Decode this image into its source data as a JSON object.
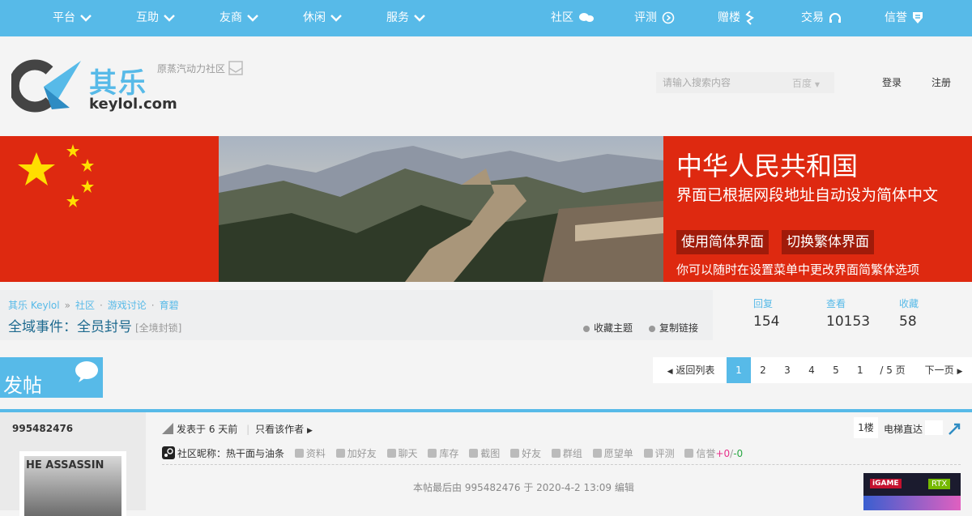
{
  "top_nav": {
    "left": [
      {
        "label": "平台"
      },
      {
        "label": "互助"
      },
      {
        "label": "友商"
      },
      {
        "label": "休闲"
      },
      {
        "label": "服务"
      }
    ],
    "right": [
      {
        "label": "社区"
      },
      {
        "label": "评测"
      },
      {
        "label": "赠楼"
      },
      {
        "label": "交易"
      },
      {
        "label": "信誉"
      }
    ]
  },
  "header": {
    "brand_cn": "其乐",
    "brand_en": "keylol.com",
    "subtitle": "原蒸汽动力社区",
    "search_placeholder": "请输入搜索内容",
    "search_engine": "百度",
    "login": "登录",
    "register": "注册"
  },
  "banner": {
    "country": "中华人民共和国",
    "notice": "界面已根据网段地址自动设为简体中文",
    "btn_simplified": "使用简体界面",
    "btn_traditional": "切换繁体界面",
    "hint": "你可以随时在设置菜单中更改界面简繁体选项",
    "colors": {
      "flag_red": "#de2910",
      "star_yellow": "#ffde00"
    }
  },
  "breadcrumb": [
    "其乐 Keylol",
    "社区",
    "游戏讨论",
    "育碧"
  ],
  "thread": {
    "title": "全域事件：全员封号",
    "tag": "[全境封锁]",
    "fav": "收藏主题",
    "copy": "复制链接"
  },
  "stats": [
    {
      "label": "回复",
      "value": "154"
    },
    {
      "label": "查看",
      "value": "10153"
    },
    {
      "label": "收藏",
      "value": "58"
    }
  ],
  "post_button": "发帖",
  "pagination": {
    "back": "返回列表",
    "pages": [
      "1",
      "2",
      "3",
      "4",
      "5"
    ],
    "current": "1",
    "input_value": "1",
    "total": "/ 5 页",
    "next": "下一页"
  },
  "post": {
    "author": "995482476",
    "avatar_text": "HE ASSASSIN",
    "posted": "发表于 6 天前",
    "only_author": "只看该作者",
    "floor": "1楼",
    "jump": "电梯直达",
    "nickname": "社区昵称：热干面与油条",
    "tools": [
      "资料",
      "加好友",
      "聊天",
      "库存",
      "截图",
      "好友",
      "群组",
      "愿望单",
      "评测"
    ],
    "rep_label": "信誉",
    "rep_plus": "+0",
    "rep_sep": "/",
    "rep_minus": "-0",
    "edited": "本帖最后由 995482476 于 2020-4-2 13:09 编辑",
    "ad_brand": "iGAME",
    "ad_product": "RTX"
  },
  "accent_color": "#57bae8"
}
